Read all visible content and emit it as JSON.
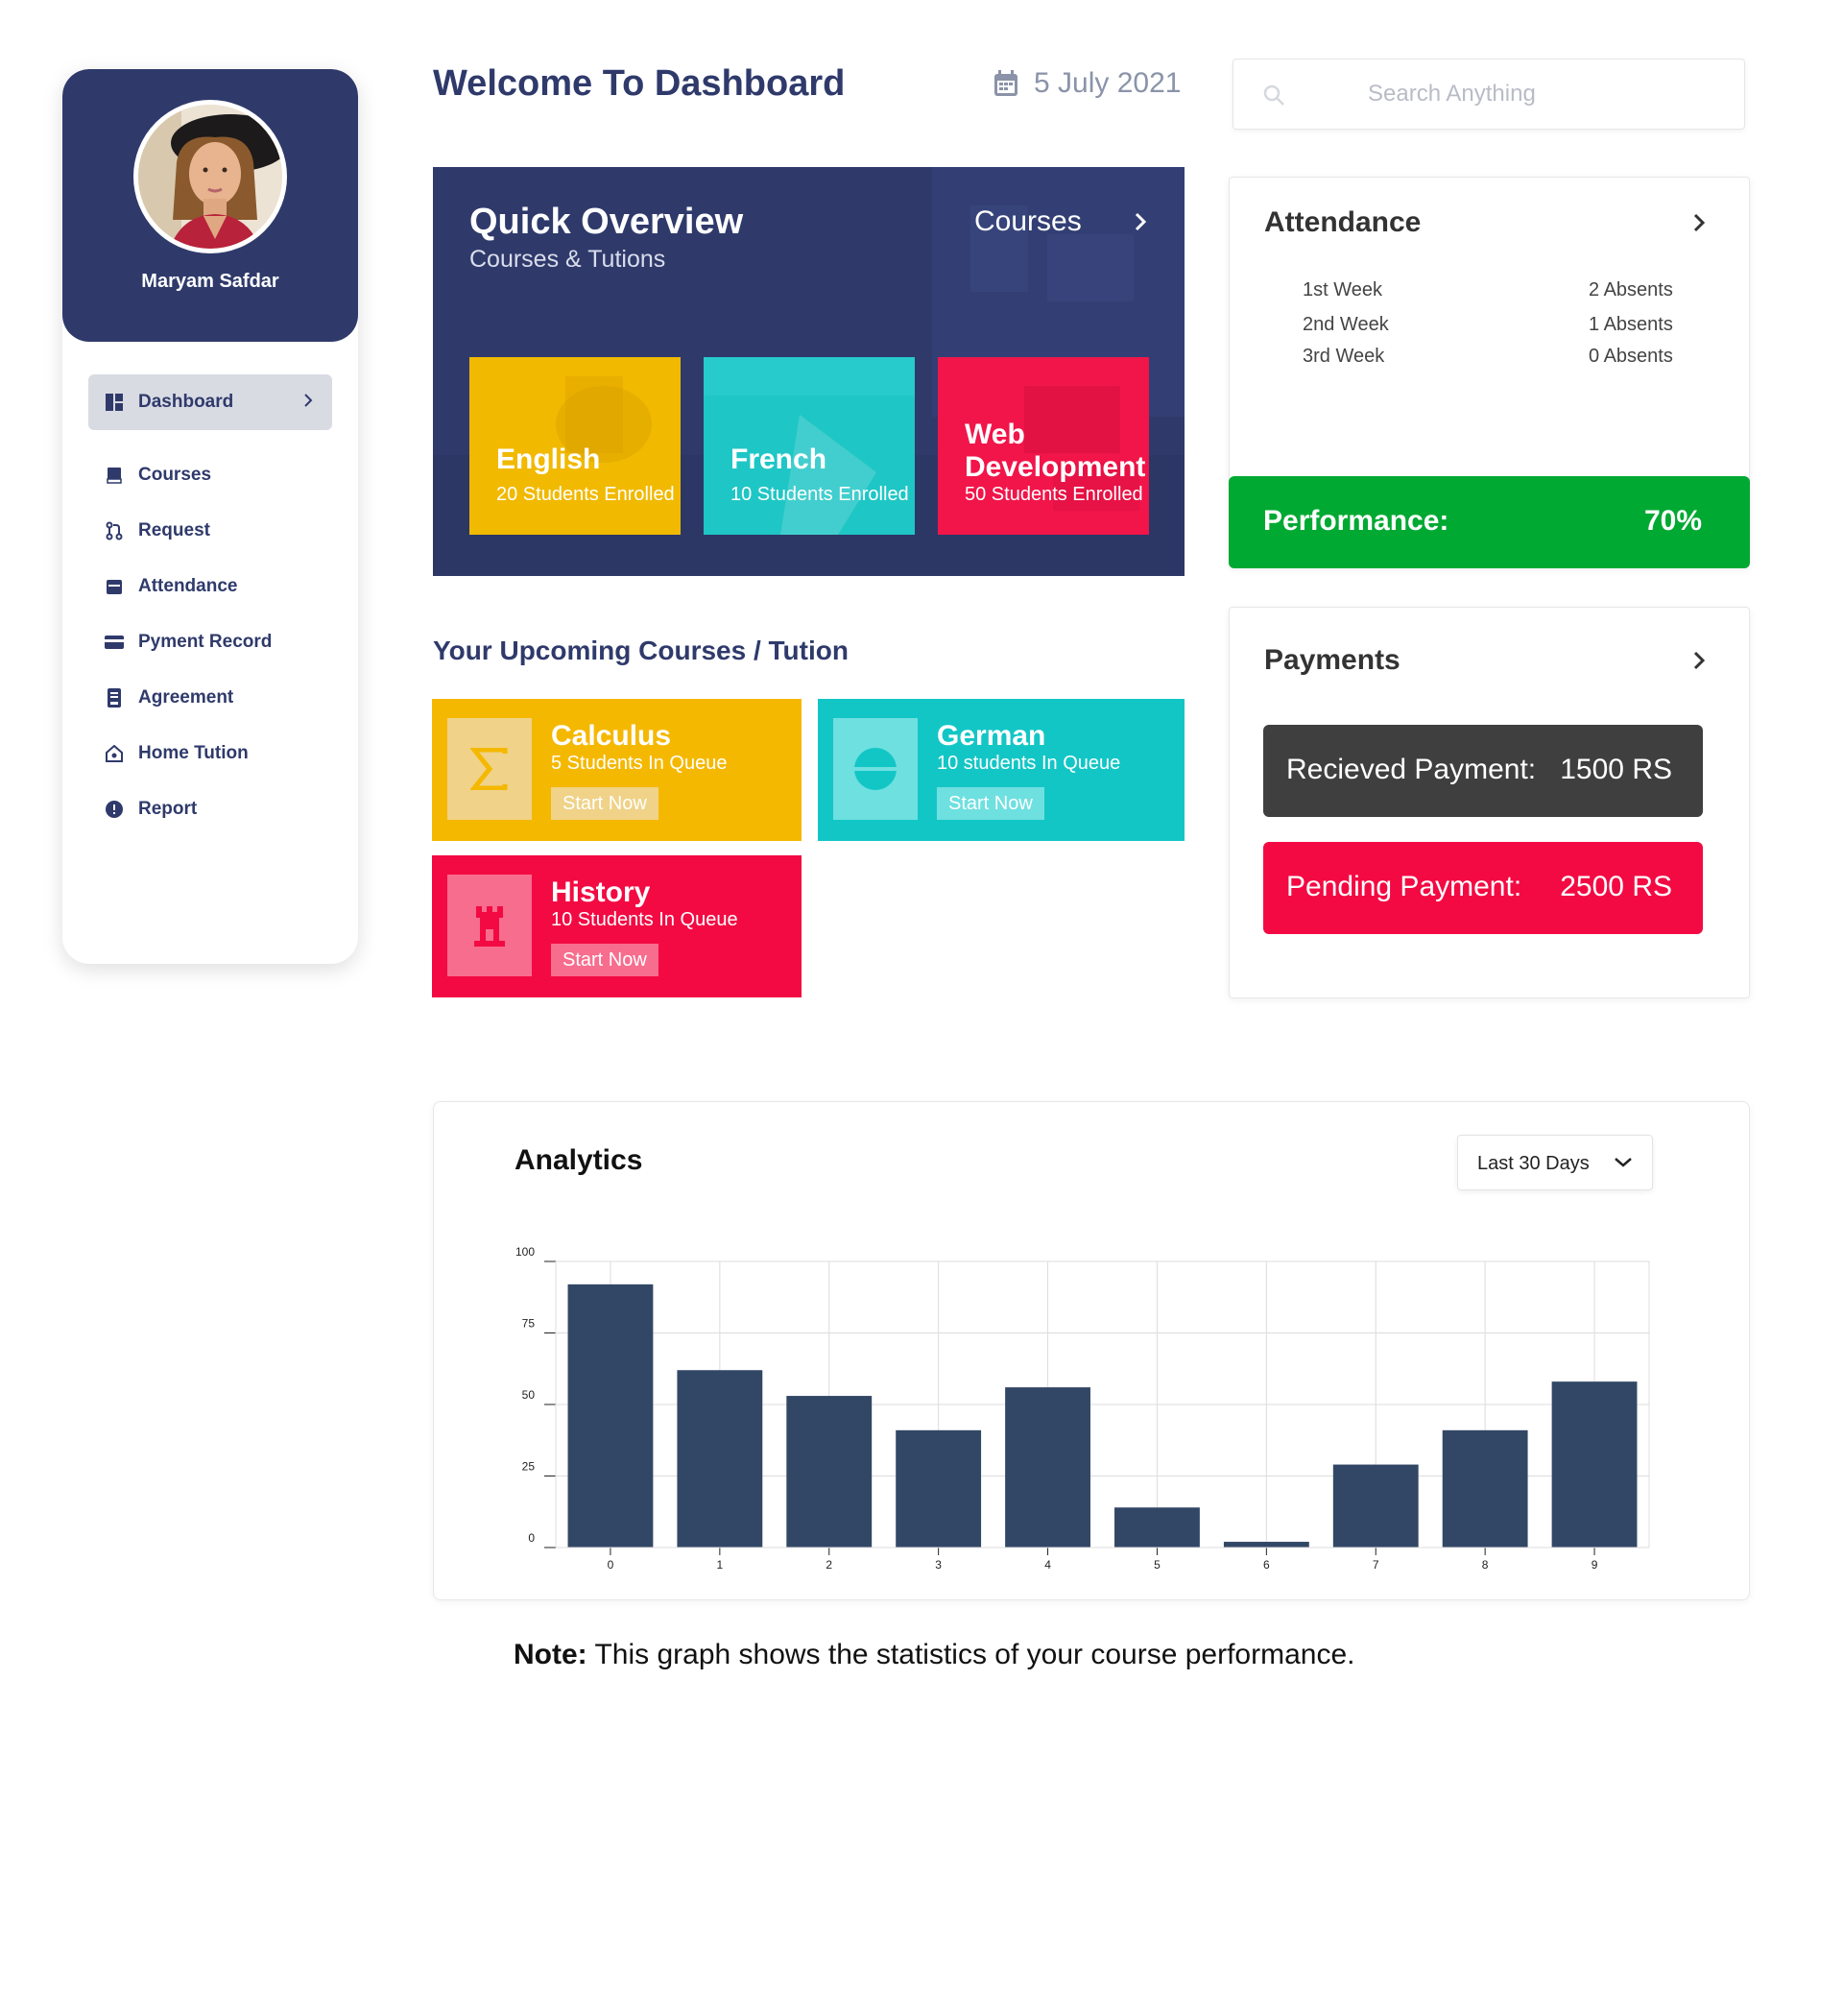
{
  "profile": {
    "name": "Maryam Safdar"
  },
  "nav": {
    "items": [
      {
        "label": "Dashboard",
        "icon": "dashboard-icon"
      },
      {
        "label": "Courses",
        "icon": "book-icon"
      },
      {
        "label": "Request",
        "icon": "pull-request-icon"
      },
      {
        "label": "Attendance",
        "icon": "calendar-icon"
      },
      {
        "label": "Pyment Record",
        "icon": "credit-card-icon"
      },
      {
        "label": "Agreement",
        "icon": "document-icon"
      },
      {
        "label": "Home Tution",
        "icon": "home-icon"
      },
      {
        "label": "Report",
        "icon": "alert-circle-icon"
      }
    ]
  },
  "header": {
    "title": "Welcome To Dashboard",
    "date": "5 July 2021",
    "search_placeholder": "Search Anything"
  },
  "overview": {
    "title": "Quick Overview",
    "subtitle": "Courses & Tutions",
    "courses_link": "Courses",
    "cards": [
      {
        "name": "English",
        "sub": "20 Students Enrolled",
        "color": "#f1b900"
      },
      {
        "name": "French",
        "sub": "10 Students Enrolled",
        "color": "#1fc6c6"
      },
      {
        "name_line1": "Web",
        "name_line2": "Development",
        "sub": "50 Students Enrolled",
        "color": "#f1154a"
      }
    ]
  },
  "upcoming": {
    "title": "Your Upcoming Courses / Tution",
    "cards": [
      {
        "name": "Calculus",
        "sub": "5 Students In Queue",
        "button": "Start Now",
        "color": "#f5b800",
        "icon": "sigma-icon"
      },
      {
        "name": "German",
        "sub": "10 students In Queue",
        "button": "Start Now",
        "color": "#13c6c6",
        "icon": "flag-circle-icon"
      },
      {
        "name": "History",
        "sub": "10 Students In Queue",
        "button": "Start Now",
        "color": "#f30a43",
        "icon": "castle-icon"
      }
    ]
  },
  "attendance": {
    "title": "Attendance",
    "rows": [
      {
        "week": "1st Week",
        "absents": "2 Absents"
      },
      {
        "week": "2nd Week",
        "absents": "1 Absents"
      },
      {
        "week": "3rd Week",
        "absents": "0 Absents"
      }
    ],
    "performance_label": "Performance:",
    "performance_value": "70%",
    "performance_color": "#00a932"
  },
  "payments": {
    "title": "Payments",
    "received_label": "Recieved Payment:",
    "received_value": "1500 RS",
    "pending_label": "Pending Payment:",
    "pending_value": "2500 RS",
    "received_color": "#3f3f3f",
    "pending_color": "#f30a43"
  },
  "analytics": {
    "title": "Analytics",
    "range": "Last 30 Days"
  },
  "chart_data": {
    "type": "bar",
    "categories": [
      "0",
      "1",
      "2",
      "3",
      "4",
      "5",
      "6",
      "7",
      "8",
      "9"
    ],
    "values": [
      92,
      62,
      53,
      41,
      56,
      14,
      2,
      29,
      41,
      58
    ],
    "ylim": [
      0,
      100
    ],
    "yticks": [
      "0",
      "25",
      "50",
      "75",
      "100"
    ],
    "grid": true,
    "bar_color": "#324766"
  },
  "note": {
    "bold": "Note:",
    "text": " This graph shows the statistics of your course performance."
  }
}
